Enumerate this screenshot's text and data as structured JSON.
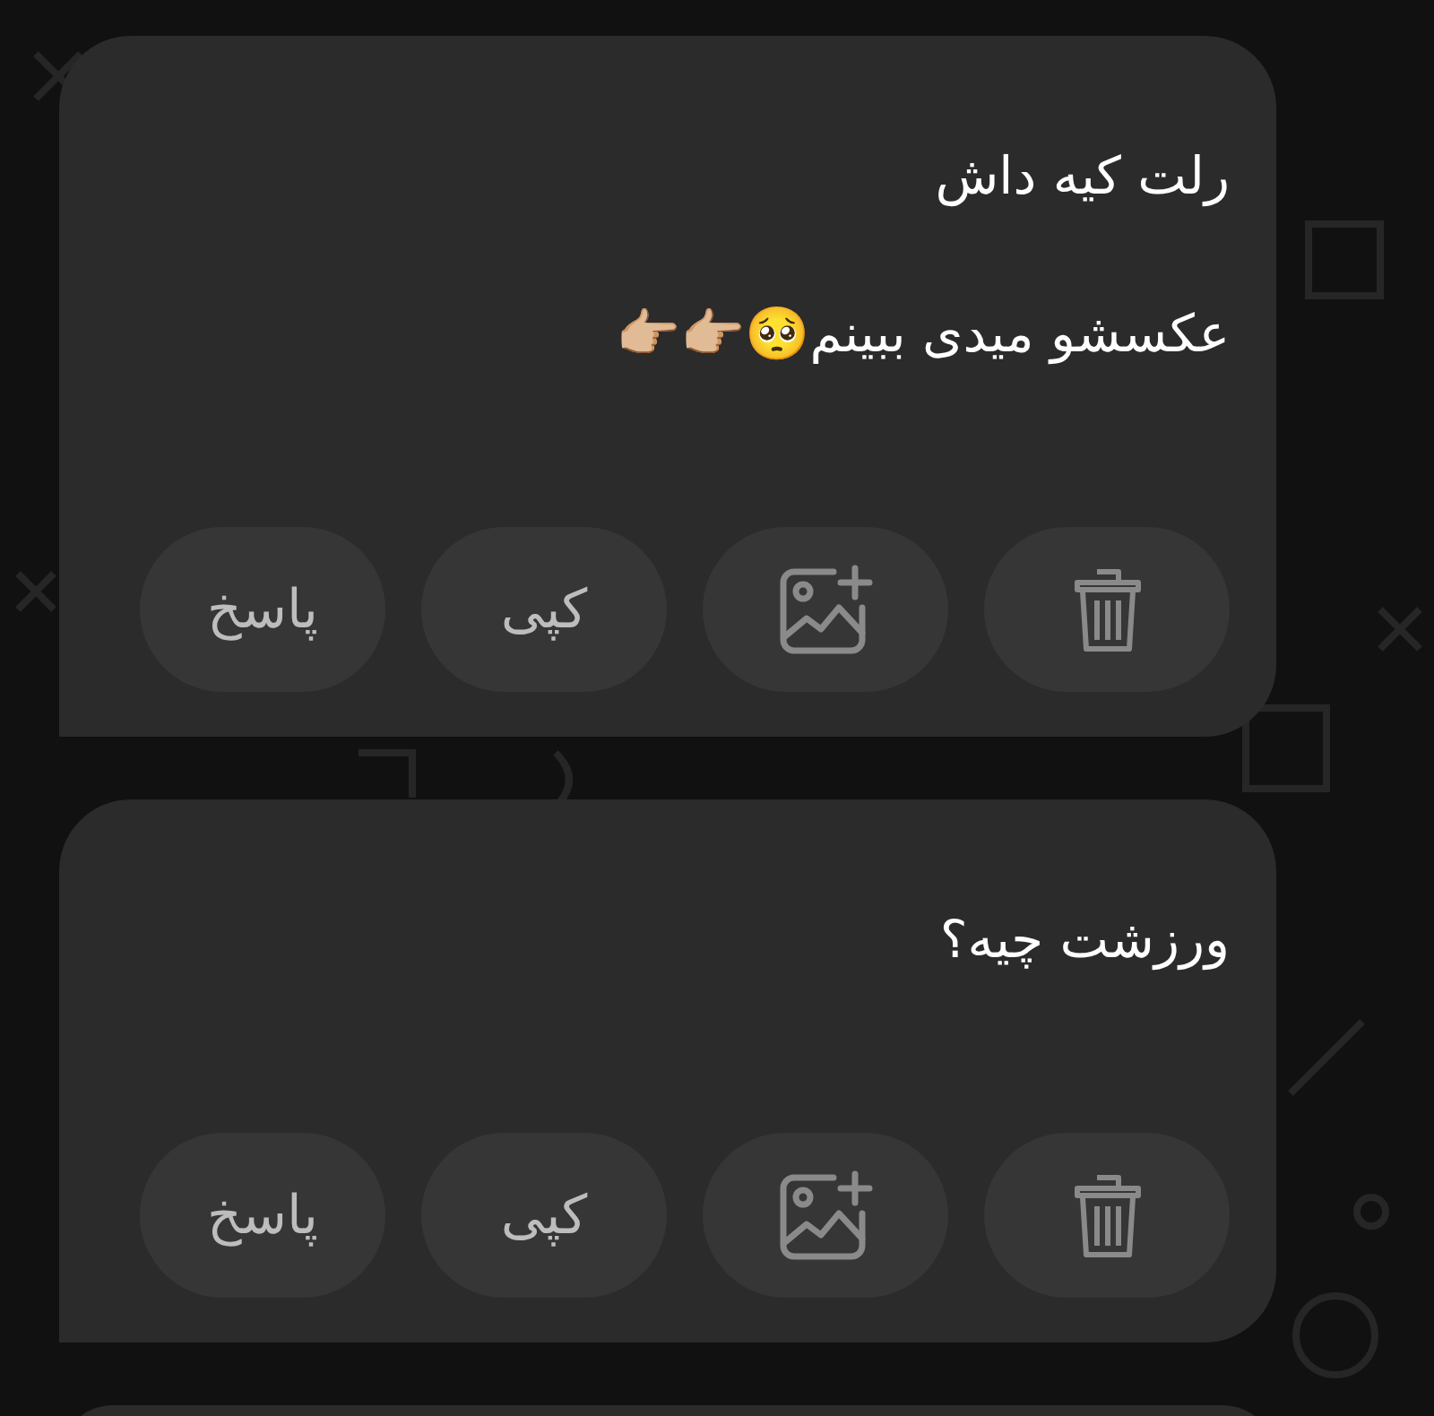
{
  "messages": [
    {
      "lines": [
        "رلت کیه داش",
        "عکسشو میدی ببینم🥺👉🏼👉🏼"
      ],
      "actions": [
        {
          "kind": "delete"
        },
        {
          "kind": "add-image"
        },
        {
          "kind": "text",
          "label": "کپی"
        },
        {
          "kind": "text",
          "label": "پاسخ"
        }
      ]
    },
    {
      "lines": [
        "ورزشت چیه؟"
      ],
      "actions": [
        {
          "kind": "delete"
        },
        {
          "kind": "add-image"
        },
        {
          "kind": "text",
          "label": "کپی"
        },
        {
          "kind": "text",
          "label": "پاسخ"
        }
      ]
    }
  ]
}
